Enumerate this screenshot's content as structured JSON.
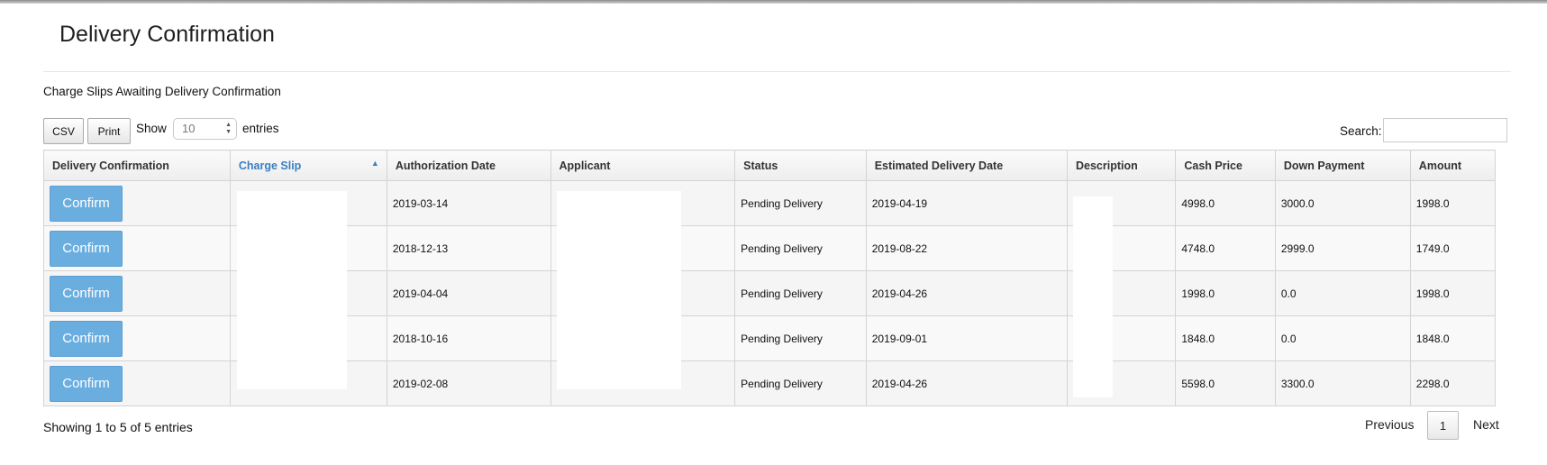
{
  "page": {
    "title": "Delivery Confirmation",
    "subtitle": "Charge Slips Awaiting Delivery Confirmation"
  },
  "toolbar": {
    "csv_label": "CSV",
    "print_label": "Print",
    "show_label": "Show",
    "length_value": "10",
    "entries_label": "entries",
    "search_label": "Search:",
    "search_value": ""
  },
  "table": {
    "columns": [
      "Delivery Confirmation",
      "Charge Slip",
      "Authorization Date",
      "Applicant",
      "Status",
      "Estimated Delivery Date",
      "Description",
      "Cash Price",
      "Down Payment",
      "Amount"
    ],
    "sorted_column": "Charge Slip",
    "sort_direction": "ascending",
    "confirm_label": "Confirm",
    "rows": [
      {
        "auth_date": "2019-03-14",
        "status": "Pending Delivery",
        "est_date": "2019-04-19",
        "cash": "4998.0",
        "down": "3000.0",
        "amount": "1998.0"
      },
      {
        "auth_date": "2018-12-13",
        "status": "Pending Delivery",
        "est_date": "2019-08-22",
        "cash": "4748.0",
        "down": "2999.0",
        "amount": "1749.0"
      },
      {
        "auth_date": "2019-04-04",
        "status": "Pending Delivery",
        "est_date": "2019-04-26",
        "cash": "1998.0",
        "down": "0.0",
        "amount": "1998.0"
      },
      {
        "auth_date": "2018-10-16",
        "status": "Pending Delivery",
        "est_date": "2019-09-01",
        "cash": "1848.0",
        "down": "0.0",
        "amount": "1848.0"
      },
      {
        "auth_date": "2019-02-08",
        "status": "Pending Delivery",
        "est_date": "2019-04-26",
        "cash": "5598.0",
        "down": "3300.0",
        "amount": "2298.0"
      }
    ]
  },
  "footer": {
    "info": "Showing 1 to 5 of 5 entries",
    "previous_label": "Previous",
    "current_page": "1",
    "next_label": "Next"
  },
  "colors": {
    "confirm_button": "#6aaee0",
    "sorted_header": "#3a7fc1"
  }
}
